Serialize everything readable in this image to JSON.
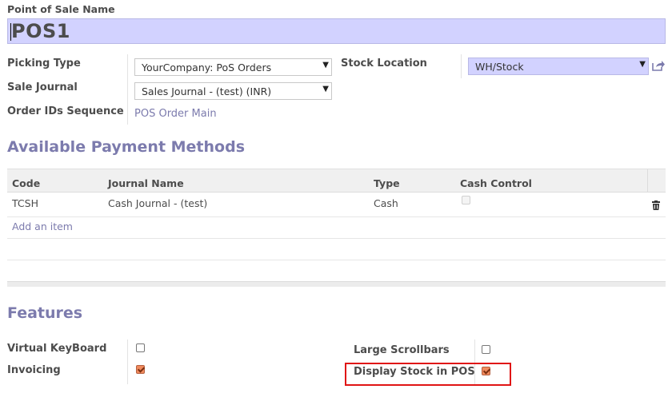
{
  "form": {
    "name_label": "Point of Sale Name",
    "name_value": "POS1",
    "picking_type_label": "Picking Type",
    "picking_type_value": "YourCompany: PoS Orders",
    "sale_journal_label": "Sale Journal",
    "sale_journal_value": "Sales Journal - (test) (INR)",
    "order_seq_label": "Order IDs Sequence",
    "order_seq_value": "POS Order Main",
    "stock_location_label": "Stock Location",
    "stock_location_value": "WH/Stock"
  },
  "payment": {
    "title": "Available Payment Methods",
    "columns": [
      "Code",
      "Journal Name",
      "Type",
      "Cash Control"
    ],
    "rows": [
      {
        "code": "TCSH",
        "journal": "Cash Journal - (test)",
        "type": "Cash",
        "cash_control": false
      }
    ],
    "add_item": "Add an item"
  },
  "features": {
    "title": "Features",
    "virtual_keyboard_label": "Virtual KeyBoard",
    "virtual_keyboard": false,
    "invoicing_label": "Invoicing",
    "invoicing": true,
    "large_scrollbars_label": "Large Scrollbars",
    "large_scrollbars": false,
    "display_stock_label": "Display Stock in POS",
    "display_stock": true
  },
  "colors": {
    "accent": "#7c7bad",
    "required_field": "#d2d2ff",
    "highlight_box": "#e01414",
    "checkbox_checked": "#f08a5d"
  },
  "icons": {
    "external_link": "external-link-icon",
    "trash": "trash-icon",
    "dropdown": "chevron-down-icon"
  }
}
